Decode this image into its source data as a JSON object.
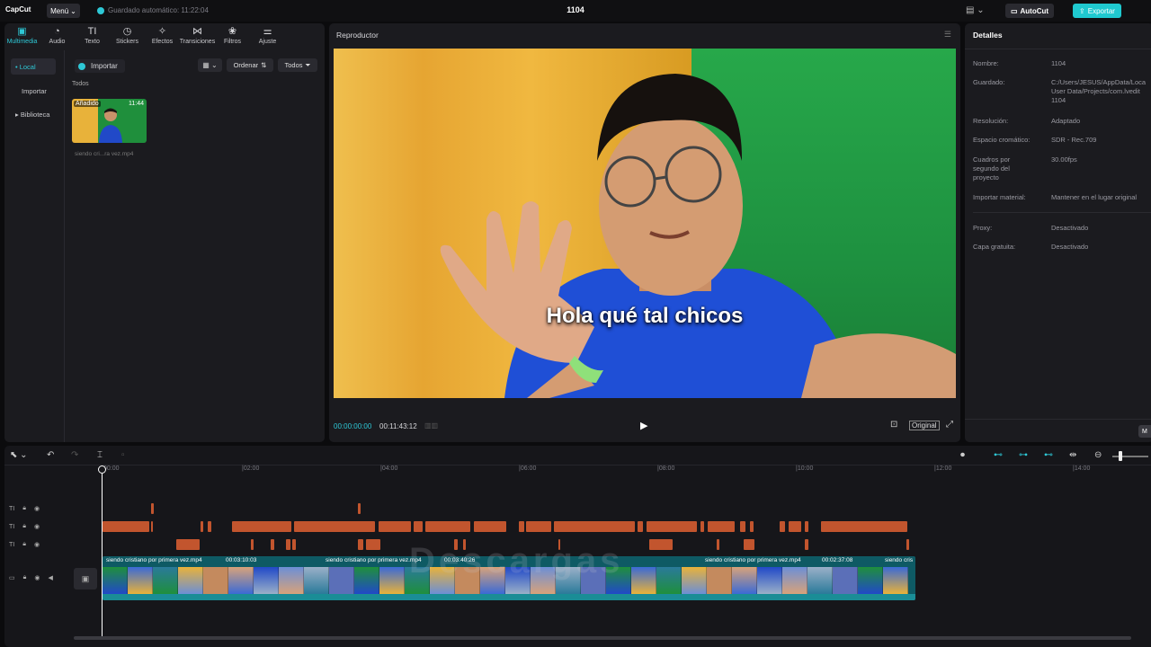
{
  "app": {
    "logo": "CapCut",
    "menu_label": "Menú",
    "autosave": "Guardado automático: 11:22:04",
    "project_name": "1104",
    "autocut_label": "AutoCut",
    "export_label": "Exportar"
  },
  "media": {
    "tools": [
      {
        "label": "Multimedia",
        "icon": "media-icon",
        "glyph": "▣",
        "active": true
      },
      {
        "label": "Audio",
        "icon": "audio-icon",
        "glyph": "◔",
        "active": false
      },
      {
        "label": "Texto",
        "icon": "text-icon",
        "glyph": "TI",
        "active": false
      },
      {
        "label": "Stickers",
        "icon": "sticker-icon",
        "glyph": "◷",
        "active": false
      },
      {
        "label": "Efectos",
        "icon": "effects-icon",
        "glyph": "✧",
        "active": false
      },
      {
        "label": "Transiciones",
        "icon": "transitions-icon",
        "glyph": "⋈",
        "active": false
      },
      {
        "label": "Filtros",
        "icon": "filters-icon",
        "glyph": "❀",
        "active": false
      },
      {
        "label": "Ajuste",
        "icon": "adjust-icon",
        "glyph": "⚌",
        "active": false
      }
    ],
    "side_items": [
      "• Local",
      "Importar",
      "▸ Biblioteca"
    ],
    "import_label": "Importar",
    "sort_label": "Ordenar",
    "filter_label": "Todos",
    "section_label": "Todos",
    "item": {
      "badge": "Añadido",
      "duration": "11:44",
      "name": "siendo cri...ra vez.mp4"
    }
  },
  "player": {
    "title": "Reproductor",
    "subtitle": "Hola qué tal chicos",
    "current_time": "00:00:00:00",
    "total_time": "00:11:43:12",
    "original_label": "Original"
  },
  "details": {
    "title": "Detalles",
    "rows": [
      {
        "k": "Nombre:",
        "v": "1104"
      },
      {
        "k": "Guardado:",
        "v": "C:/Users/JESUS/AppData/Loca\nUser Data/Projects/com.lvedit\n1104"
      },
      {
        "k": "Resolución:",
        "v": "Adaptado"
      },
      {
        "k": "Espacio cromático:",
        "v": "SDR - Rec.709"
      },
      {
        "k": "Cuadros por\nsegundo del\nproyecto",
        "v": "30.00fps"
      },
      {
        "k": "Importar material:",
        "v": "Mantener en el lugar original"
      },
      {
        "k": "Proxy:",
        "v": "Desactivado"
      },
      {
        "k": "Capa gratuita:",
        "v": "Desactivado"
      }
    ],
    "modify_label": "M"
  },
  "timeline": {
    "ruler": [
      "00:00",
      "|02:00",
      "|04:00",
      "|06:00",
      "|08:00",
      "|10:00",
      "|12:00",
      "|14:00"
    ],
    "clips": [
      {
        "name": "siendo cristiano por primera vez.mp4",
        "time": "00:03:10:03"
      },
      {
        "name": "siendo cristiano por primera vez.mp4",
        "time": "00:03:40:26"
      },
      {
        "name": "siendo cristiano por primera vez.mp4",
        "time": "00:02:37:08"
      },
      {
        "name": "siendo cris",
        "time": ""
      }
    ],
    "watermark": "Descargas"
  },
  "colors": {
    "accent": "#2ec8d6",
    "text_clip": "#c2552e",
    "video_clip": "#0e5a64"
  }
}
